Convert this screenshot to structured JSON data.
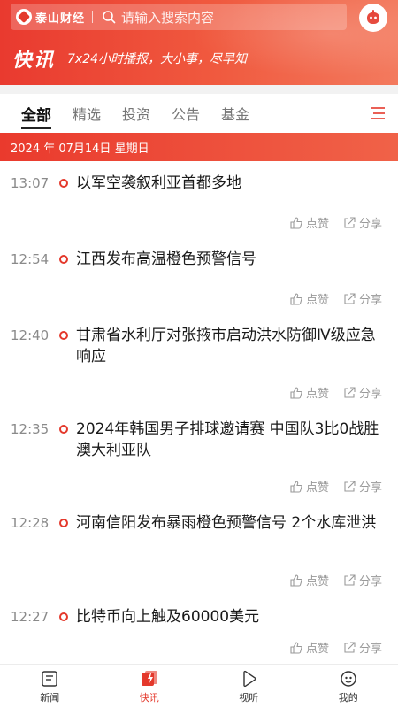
{
  "header": {
    "logo_text": "泰山财经",
    "search_placeholder": "请输入搜索内容",
    "title": "快讯",
    "subtitle": "7x24小时播报，大小事，尽早知",
    "accent_color": "#e4392c"
  },
  "tabs": [
    {
      "label": "全部",
      "active": true
    },
    {
      "label": "精选",
      "active": false
    },
    {
      "label": "投资",
      "active": false
    },
    {
      "label": "公告",
      "active": false
    },
    {
      "label": "基金",
      "active": false
    }
  ],
  "date_bar": "2024 年 07月14日 星期日",
  "actions": {
    "like": "点赞",
    "share": "分享"
  },
  "feed": [
    {
      "time": "13:07",
      "text": "以军空袭叙利亚首都多地"
    },
    {
      "time": "12:54",
      "text": "江西发布高温橙色预警信号"
    },
    {
      "time": "12:40",
      "text": "甘肃省水利厅对张掖市启动洪水防御Ⅳ级应急响应"
    },
    {
      "time": "12:35",
      "text": "2024年韩国男子排球邀请赛 中国队3比0战胜澳大利亚队"
    },
    {
      "time": "12:28",
      "text": "河南信阳发布暴雨橙色预警信号 2个水库泄洪"
    },
    {
      "time": "12:27",
      "text": "比特币向上触及60000美元"
    }
  ],
  "bottom_nav": [
    {
      "label": "新闻",
      "icon": "news-icon",
      "active": false
    },
    {
      "label": "快讯",
      "icon": "flash-icon",
      "active": true
    },
    {
      "label": "视听",
      "icon": "play-icon",
      "active": false
    },
    {
      "label": "我的",
      "icon": "profile-icon",
      "active": false
    }
  ]
}
